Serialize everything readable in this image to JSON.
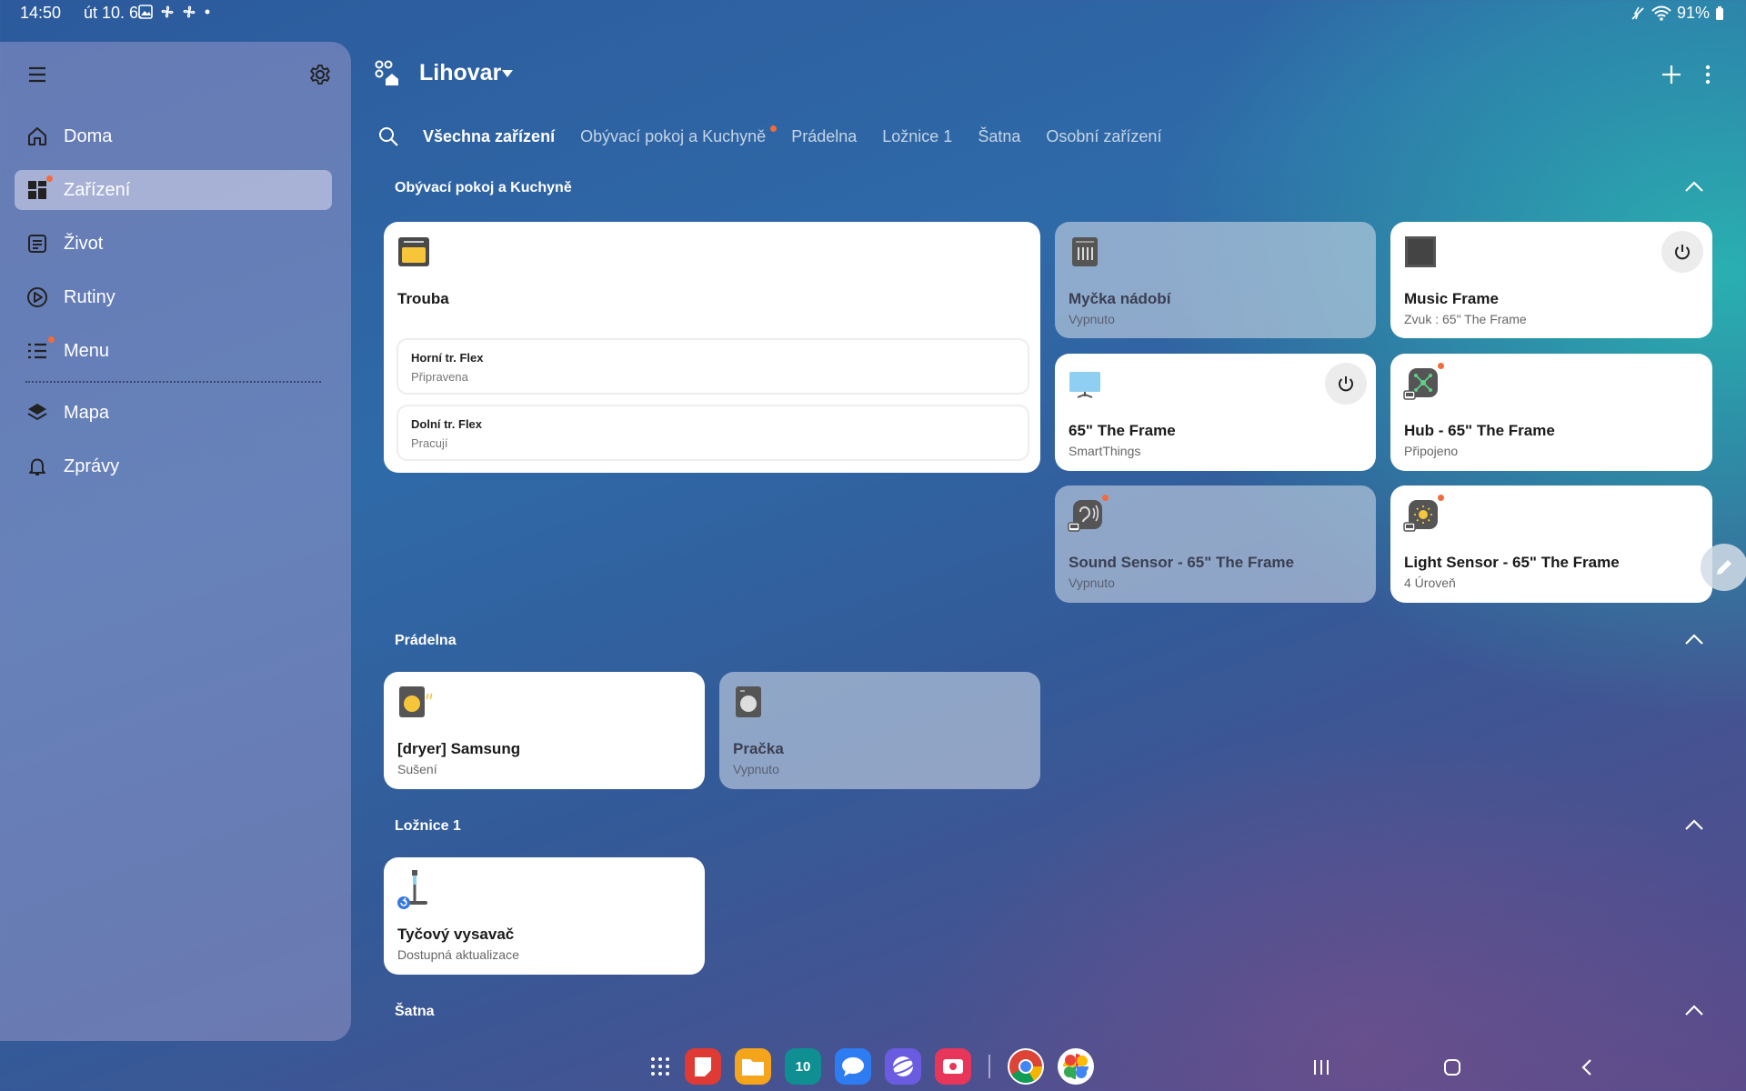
{
  "status_bar": {
    "time": "14:50",
    "date": "út 10. 6.",
    "battery": "91%",
    "icons": [
      "gallery-icon",
      "fan-icon",
      "fan-icon",
      "dot-icon"
    ]
  },
  "sidebar": {
    "items": [
      {
        "label": "Doma",
        "icon": "home-icon"
      },
      {
        "label": "Zařízení",
        "icon": "devices-icon",
        "active": true,
        "badge": true
      },
      {
        "label": "Život",
        "icon": "life-icon"
      },
      {
        "label": "Rutiny",
        "icon": "routines-icon"
      },
      {
        "label": "Menu",
        "icon": "menu-list-icon",
        "badge": true
      },
      {
        "label": "Mapa",
        "icon": "map-icon"
      },
      {
        "label": "Zprávy",
        "icon": "bell-icon"
      }
    ]
  },
  "header": {
    "home_name": "Lihovar"
  },
  "tabs": [
    {
      "label": "Všechna zařízení",
      "active": true
    },
    {
      "label": "Obývací pokoj a Kuchyně",
      "badge": true
    },
    {
      "label": "Prádelna"
    },
    {
      "label": "Ložnice 1"
    },
    {
      "label": "Šatna"
    },
    {
      "label": "Osobní zařízení"
    }
  ],
  "sections": {
    "living": {
      "title": "Obývací pokoj a Kuchyně",
      "cards": {
        "oven": {
          "name": "Trouba",
          "sub": [
            {
              "name": "Horní tr. Flex",
              "status": "Připravena"
            },
            {
              "name": "Dolní tr. Flex",
              "status": "Pracují"
            }
          ]
        },
        "dishwasher": {
          "name": "Myčka nádobí",
          "status": "Vypnuto"
        },
        "music_frame": {
          "name": "Music Frame",
          "status": "Zvuk : 65\" The Frame"
        },
        "tv": {
          "name": "65\" The Frame",
          "status": "SmartThings"
        },
        "hub": {
          "name": "Hub - 65\" The Frame",
          "status": "Připojeno"
        },
        "sound_sensor": {
          "name": "Sound Sensor - 65\" The Frame",
          "status": "Vypnuto"
        },
        "light_sensor": {
          "name": "Light Sensor - 65\" The Frame",
          "status": "4 Úroveň"
        }
      }
    },
    "laundry": {
      "title": "Prádelna",
      "cards": {
        "dryer": {
          "name": "[dryer] Samsung",
          "status": "Sušení"
        },
        "washer": {
          "name": "Pračka",
          "status": "Vypnuto"
        }
      }
    },
    "bedroom": {
      "title": "Ložnice 1",
      "cards": {
        "vacuum": {
          "name": "Tyčový vysavač",
          "status": "Dostupná aktualizace"
        }
      }
    },
    "closet": {
      "title": "Šatna"
    }
  },
  "dock": {
    "calendar_day": "10",
    "apps": [
      "app-grid-icon",
      "flipnote-app-icon",
      "my-files-app-icon",
      "calendar-app-icon",
      "messages-app-icon",
      "internet-app-icon",
      "screen-recorder-app-icon",
      "chrome-app-icon",
      "photos-app-icon"
    ]
  },
  "colors": {
    "accent_badge": "#f26b3a",
    "card_on": "#ffffff",
    "card_off": "#c8d3e2"
  }
}
